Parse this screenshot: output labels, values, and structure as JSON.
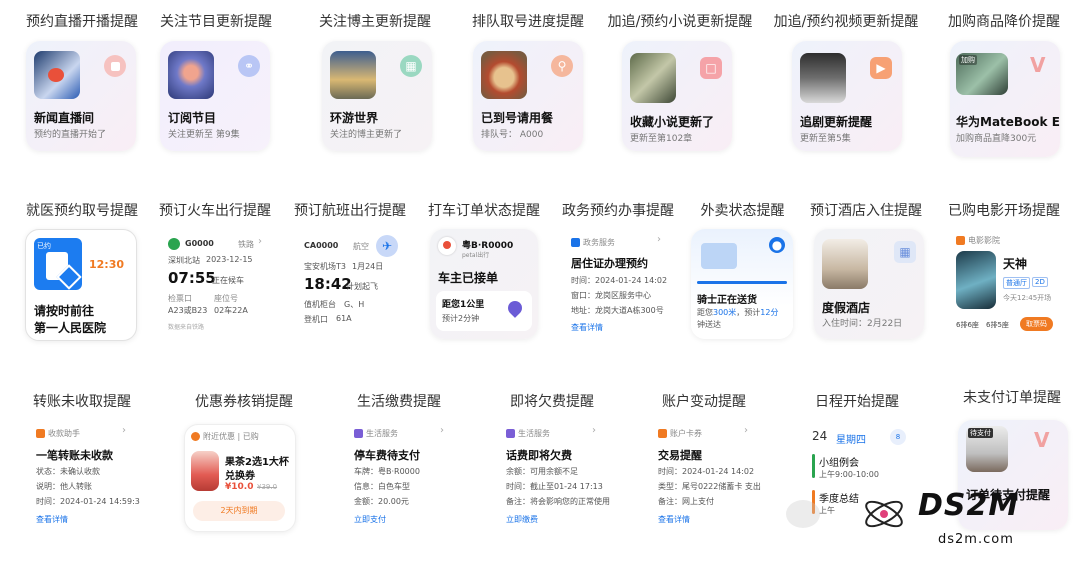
{
  "row1": {
    "titles": [
      "预约直播开播提醒",
      "关注节目更新提醒",
      "关注博主更新提醒",
      "排队取号进度提醒",
      "加追/预约小说更新提醒",
      "加追/预约视频更新提醒",
      "加购商品降价提醒"
    ],
    "cards": [
      {
        "title": "新闻直播间",
        "sub": "预约的直播开始了"
      },
      {
        "title": "订阅节目",
        "sub": "关注更新至 第9集"
      },
      {
        "title": "环游世界",
        "sub": "关注的博主更新了"
      },
      {
        "title": "已到号请用餐",
        "sub": "排队号：  A000"
      },
      {
        "title": "收藏小说更新了",
        "sub": "更新至第102章"
      },
      {
        "title": "追剧更新提醒",
        "sub": "更新至第5集"
      },
      {
        "title": "华为MateBook E",
        "sub": "加购商品直降300元",
        "badge": "加购"
      }
    ]
  },
  "row2": {
    "titles": [
      "就医预约取号提醒",
      "预订火车出行提醒",
      "预订航班出行提醒",
      "打车订单状态提醒",
      "政务预约办事提醒",
      "外卖状态提醒",
      "预订酒店入住提醒",
      "已购电影开场提醒"
    ],
    "hospital": {
      "badge": "已约",
      "time": "12:30",
      "line1": "请按时前往",
      "line2": "第一人民医院"
    },
    "train": {
      "no": "G0000",
      "tag": "铁路",
      "from": "深圳北站",
      "date": "2023-12-15",
      "time": "07:55",
      "status": "正在候车",
      "gate_label": "检票口",
      "seat_label": "座位号",
      "gate": "A23或B23",
      "seat": "02车22A",
      "footer": "数据来自铁路"
    },
    "flight": {
      "no": "CA0000",
      "tag": "航空",
      "airport": "宝安机场T3",
      "date": "1月24日",
      "time": "18:42",
      "status": "计划起飞",
      "counter_label": "值机柜台",
      "counter": "G、H",
      "boarding_label": "登机口",
      "boarding": "61A"
    },
    "taxi": {
      "plate": "粤B·R0000",
      "app": "petal出行",
      "status": "车主已接单",
      "dist": "距您1公里",
      "eta": "预计2分钟"
    },
    "gov": {
      "head": "政务服务",
      "title": "居住证办理预约",
      "time_label": "时间：",
      "time": "2024-01-24 14:02",
      "window_label": "窗口：",
      "window": "龙岗区服务中心",
      "addr_label": "地址：",
      "addr": "龙岗大道A栋300号",
      "link": "查看详情"
    },
    "delivery": {
      "status": "骑士正在送货",
      "detail1": "距您",
      "dist": "300米",
      "detail2": "，预计",
      "eta": "12分",
      "detail3": "钟送达"
    },
    "hotel": {
      "title": "度假酒店",
      "sub": "入住时间：2月22日"
    },
    "movie": {
      "head": "电影影院",
      "title": "天神",
      "tag1": "普通厅",
      "tag2": "2D",
      "time": "今天12:45开场",
      "seat1": "6排6座",
      "seat2": "6排5座",
      "btn": "取票码"
    }
  },
  "row3": {
    "titles": [
      "转账未收取提醒",
      "优惠券核销提醒",
      "生活缴费提醒",
      "即将欠费提醒",
      "账户变动提醒",
      "日程开始提醒",
      "未支付订单提醒"
    ],
    "transfer": {
      "head": "收款助手",
      "title": "一笔转账未收款",
      "r1l": "状态：",
      "r1": "未确认收款",
      "r2l": "说明：",
      "r2": "他人转账",
      "r3l": "时间：",
      "r3": "2024-01-24 14:59:38",
      "link": "查看详情"
    },
    "coupon": {
      "head": "附近优惠 | 已购",
      "title1": "果茶2选1大杯",
      "title2": "兑换券",
      "price": "¥10.0",
      "old": "¥39.0",
      "btn": "2天内到期"
    },
    "parking": {
      "head": "生活服务",
      "title": "停车费待支付",
      "r1l": "车牌：",
      "r1": "粤B·R0000",
      "r2l": "信息：",
      "r2": "白色车型",
      "r3l": "金额：",
      "r3": "20.00元",
      "link": "立即支付"
    },
    "arrears": {
      "head": "生活服务",
      "title": "话费即将欠费",
      "r1l": "余额：",
      "r1": "可用余额不足",
      "r2l": "时间：",
      "r2": "截止至01-24 17:13",
      "r3l": "备注：",
      "r3": "将会影响您的正常使用",
      "link": "立即缴费"
    },
    "account": {
      "head": "账户卡券",
      "title": "交易提醒",
      "r1l": "时间：",
      "r1": "2024-01-24 14:02",
      "r2l": "类型：",
      "r2": "尾号0222储蓄卡 支出",
      "r3l": "备注：",
      "r3": "网上支付",
      "link": "查看详情"
    },
    "schedule": {
      "day": "24",
      "weekday": "星期四",
      "badge": "8",
      "e1": "小组例会",
      "e1t": "上午9:00-10:00",
      "e2": "季度总结",
      "e2t": "上午"
    },
    "unpaid": {
      "badge": "待支付",
      "title": "订单待支付提醒"
    }
  },
  "watermark": {
    "brand": "DS2M",
    "site": "ds2m.com"
  },
  "colors": {
    "blue": "#1a73e8",
    "green": "#2aa44f",
    "orange": "#f07a22",
    "accent_red": "#e9503a"
  }
}
